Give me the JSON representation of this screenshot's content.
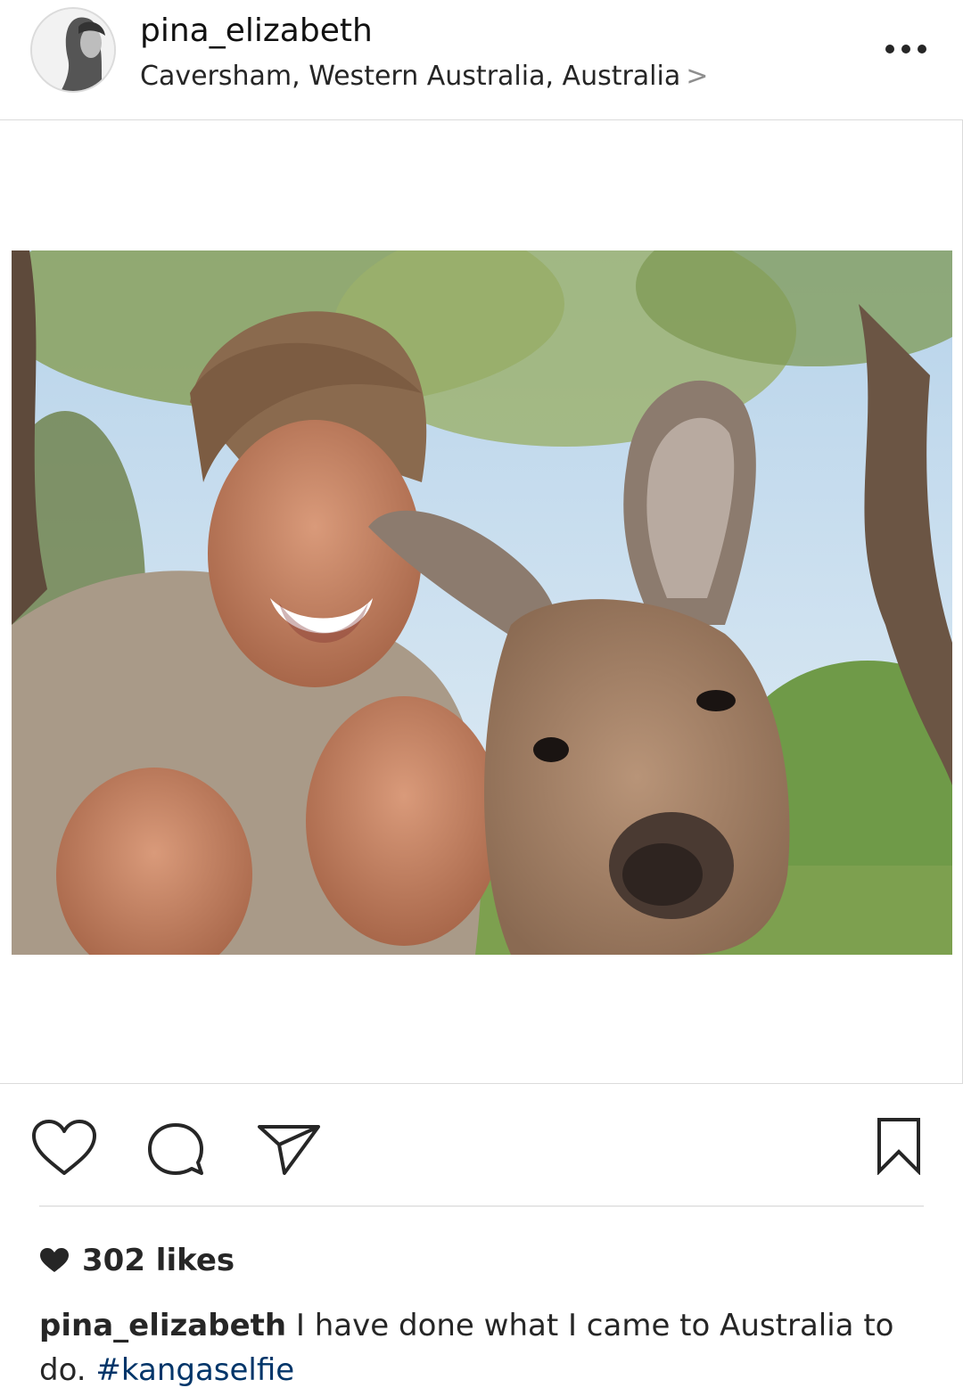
{
  "post": {
    "username": "pina_elizabeth",
    "location": "Caversham, Western Australia, Australia",
    "location_chevron": ">",
    "more_icon": "ellipsis-icon"
  },
  "actions": {
    "like_icon": "heart-outline-icon",
    "comment_icon": "comment-bubble-icon",
    "share_icon": "paper-plane-icon",
    "save_icon": "bookmark-icon"
  },
  "likes": {
    "icon": "heart-filled-icon",
    "text": "302 likes"
  },
  "caption": {
    "username": "pina_elizabeth",
    "text": " I have done what I came to Australia to do. ",
    "hashtag": "#kangaselfie"
  },
  "colors": {
    "text": "#262626",
    "hashtag": "#003569",
    "border": "#dbdbdb",
    "chevron": "#8e8e8e"
  }
}
